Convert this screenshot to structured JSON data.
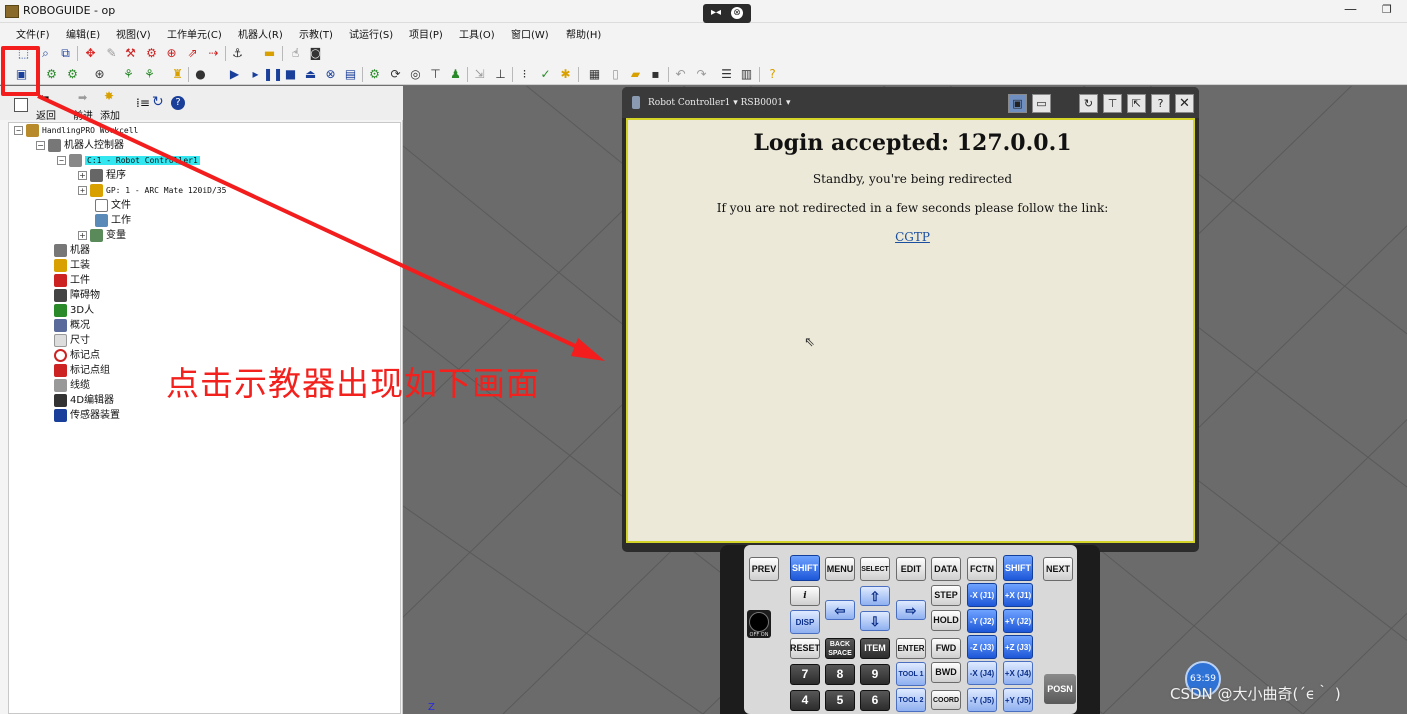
{
  "window": {
    "title": "ROBOGUIDE - op",
    "remote_icon": "▸◂",
    "remote_close": "⊗",
    "minimize": "—",
    "restore": "❐"
  },
  "menu": [
    "文件(F)",
    "编辑(E)",
    "视图(V)",
    "工作单元(C)",
    "机器人(R)",
    "示教(T)",
    "试运行(S)",
    "项目(P)",
    "工具(O)",
    "窗口(W)",
    "帮助(H)"
  ],
  "panel_toolbar": {
    "back_label": "返回",
    "forward_label": "前进",
    "add_label": "添加"
  },
  "tree": {
    "root": "HandlingPRO Workcell",
    "robot_controllers": "机器人控制器",
    "controller": "C:1 - Robot Controller1",
    "program": "程序",
    "gp": "GP: 1 - ARC Mate 120iD/35",
    "file": "文件",
    "work": "工作",
    "variables": "变量",
    "machines": "机器",
    "tooling": "工装",
    "parts": "工件",
    "obstacles": "障碍物",
    "humans_3d": "3D人",
    "overview": "概况",
    "dimension": "尺寸",
    "target": "标记点",
    "target_group": "标记点组",
    "cable": "线缆",
    "editor_4d": "4D编辑器",
    "sensor": "传感器装置"
  },
  "annotation": "点击示教器出现如下画面",
  "teach_pendant": {
    "header_title": "Robot Controller1 ▾  RSB0001 ▾",
    "close": "✕",
    "screen": {
      "heading": "Login accepted: 127.0.0.1",
      "standby": "Standby, you're being redirected",
      "redirect_note": "If you are not redirected in a few seconds please follow the link:",
      "link": "CGTP"
    },
    "keys": {
      "prev": "PREV",
      "shift": "SHIFT",
      "menu": "MENU",
      "select": "SELECT",
      "edit": "EDIT",
      "data": "DATA",
      "fctn": "FCTN",
      "next": "NEXT",
      "info": "i",
      "disp": "DISP",
      "step": "STEP",
      "hold": "HOLD",
      "reset": "RESET",
      "backspace": "BACK SPACE",
      "item": "ITEM",
      "enter": "ENTER",
      "fwd": "FWD",
      "bwd": "BWD",
      "tool1": "TOOL 1",
      "tool2": "TOOL 2",
      "coord": "COORD",
      "n7": "7",
      "n8": "8",
      "n9": "9",
      "n4": "4",
      "n5": "5",
      "n6": "6",
      "mx": "-X (J1)",
      "px": "+X (J1)",
      "my": "-Y (J2)",
      "py": "+Y (J2)",
      "mz": "-Z (J3)",
      "pz": "+Z (J3)",
      "mj4": "-X (J4)",
      "pj4": "+X (J4)",
      "mj5": "-Y (J5)",
      "pj5": "+Y (J5)",
      "posn": "POSN",
      "onoff": "OFF ON"
    }
  },
  "clock": "63:59",
  "watermark": "CSDN @大小曲奇(´ϵ｀ )",
  "axis_label": "Z",
  "colors": {
    "highlight": "#f31d1d",
    "annotation": "#f2211d",
    "selected_node": "#33e6f0",
    "screen_border": "#d4d428"
  }
}
